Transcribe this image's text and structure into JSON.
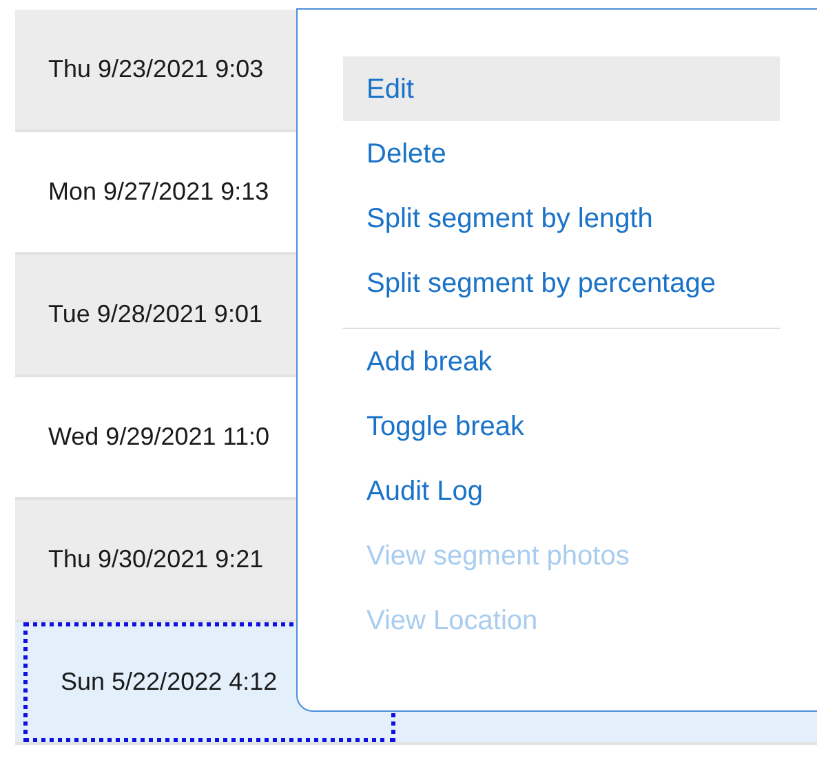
{
  "rows": [
    {
      "date": "Thu 9/23/2021 9:03",
      "selected": false,
      "focused": false
    },
    {
      "date": "Mon 9/27/2021 9:13",
      "selected": false,
      "focused": false
    },
    {
      "date": "Tue 9/28/2021 9:01",
      "selected": false,
      "focused": false
    },
    {
      "date": "Wed 9/29/2021 11:0",
      "selected": false,
      "focused": false
    },
    {
      "date": "Thu 9/30/2021 9:21",
      "selected": false,
      "focused": false
    },
    {
      "date": "Sun 5/22/2022 4:12",
      "selected": true,
      "focused": true
    }
  ],
  "context_menu": {
    "groups": [
      [
        {
          "label": "Edit",
          "highlighted": true,
          "disabled": false
        },
        {
          "label": "Delete",
          "highlighted": false,
          "disabled": false
        },
        {
          "label": "Split segment by length",
          "highlighted": false,
          "disabled": false
        },
        {
          "label": "Split segment by percentage",
          "highlighted": false,
          "disabled": false
        }
      ],
      [
        {
          "label": "Add break",
          "highlighted": false,
          "disabled": false
        },
        {
          "label": "Toggle break",
          "highlighted": false,
          "disabled": false
        },
        {
          "label": "Audit Log",
          "highlighted": false,
          "disabled": false
        },
        {
          "label": "View segment photos",
          "highlighted": false,
          "disabled": true
        },
        {
          "label": "View Location",
          "highlighted": false,
          "disabled": true
        }
      ]
    ]
  }
}
